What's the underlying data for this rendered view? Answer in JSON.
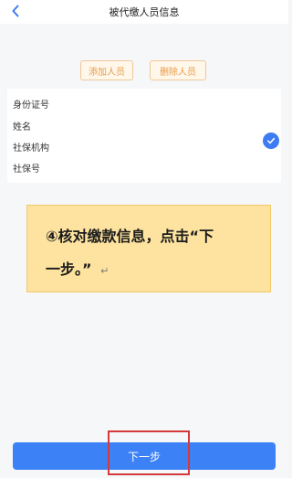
{
  "header": {
    "title": "被代缴人员信息",
    "back_icon": "chevron-left-icon"
  },
  "actions": {
    "add_label": "添加人员",
    "delete_label": "删除人员"
  },
  "info_card": {
    "fields": [
      "身份证号",
      "姓名",
      "社保机构",
      "社保号"
    ],
    "selected": true,
    "check_icon": "check-circle-icon"
  },
  "callout": {
    "line1": "④核对缴款信息，点击“下",
    "line2": "一步。”",
    "mark": "↵"
  },
  "footer": {
    "next_label": "下一步"
  },
  "colors": {
    "accent_blue": "#3c82f6",
    "outline_orange": "#e79c4a",
    "callout_yellow": "#fde39f",
    "highlight_red": "#d43a3a"
  }
}
